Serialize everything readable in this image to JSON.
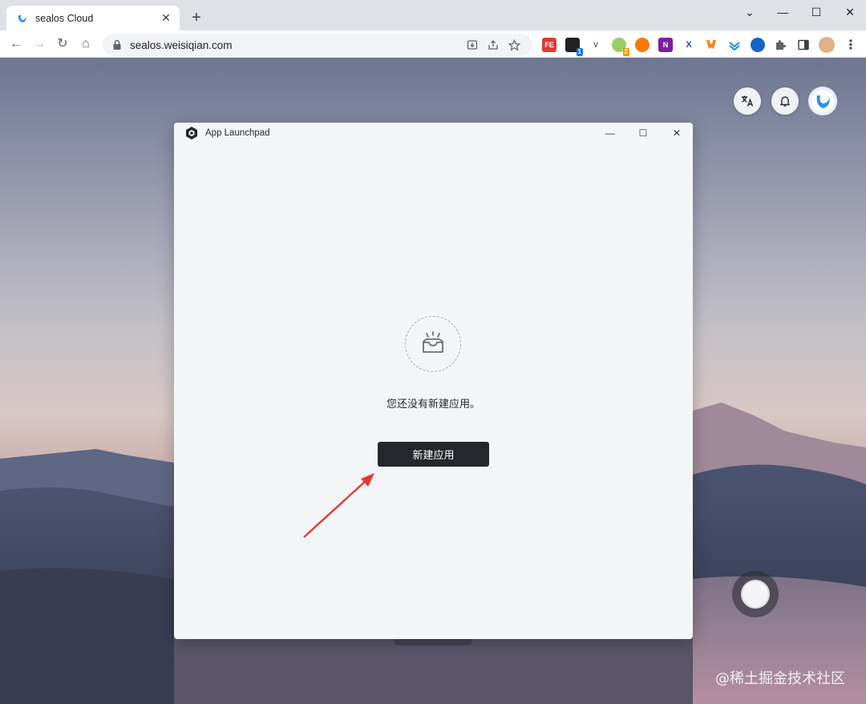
{
  "browser": {
    "tab_title": "sealos Cloud",
    "tab_close": "✕",
    "new_tab": "+",
    "url": "sealos.weisiqian.com",
    "window_controls": {
      "dropdown": "⌄",
      "minimize": "—",
      "maximize": "☐",
      "close": "✕"
    },
    "nav": {
      "back": "←",
      "forward": "→",
      "reload": "↻",
      "home": "⌂"
    },
    "extensions": [
      {
        "name": "fe-helper-extension",
        "label": "FE",
        "color": "#e53935"
      },
      {
        "name": "extension-2",
        "label": "",
        "color": "#202124",
        "badge": "1"
      },
      {
        "name": "vue-devtools-extension",
        "label": "V",
        "color": "#6b7280"
      },
      {
        "name": "extension-4",
        "label": "",
        "color": "#7cb342",
        "badge": "2"
      },
      {
        "name": "extension-5",
        "label": "",
        "color": "#f57c00"
      },
      {
        "name": "onenote-extension",
        "label": "N",
        "color": "#7b1fa2"
      },
      {
        "name": "extension-x",
        "label": "X",
        "color": "#3949ab"
      },
      {
        "name": "metamask-extension",
        "label": "",
        "color": "#f6851b"
      },
      {
        "name": "extension-9",
        "label": "",
        "color": "#1e88e5"
      },
      {
        "name": "extension-10",
        "label": "",
        "color": "#1565c0"
      }
    ]
  },
  "desktop": {
    "watermark": "@稀土掘金技术社区"
  },
  "app_window": {
    "title": "App Launchpad",
    "controls": {
      "minimize": "—",
      "maximize": "☐",
      "close": "✕"
    },
    "empty_message": "您还没有新建应用。",
    "create_button": "新建应用"
  },
  "colors": {
    "accent_dark": "#24282c",
    "annotation_arrow": "#e53935"
  }
}
